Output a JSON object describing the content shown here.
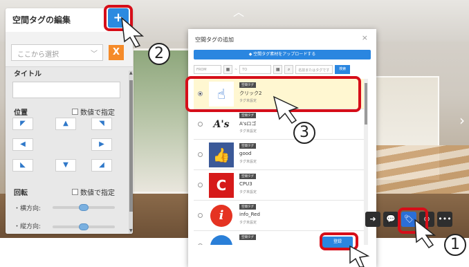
{
  "edit_panel": {
    "title": "空間タグの編集",
    "select_placeholder": "ここから選択",
    "x_label": "X",
    "title_label": "タイトル",
    "position_label": "位置",
    "position_numeric": "数値で指定",
    "rotation_label": "回転",
    "rotation_numeric": "数値で指定",
    "horizontal_label": "・横方向:",
    "vertical_label": "・縦方向:",
    "add_label": "+"
  },
  "dialog": {
    "title": "空間タグの追加",
    "close": "×",
    "upload_label": "◆ 空間タグ素材をアップロードする",
    "from_placeholder": "FROM",
    "to_placeholder": "TO",
    "tilde": "~",
    "keyword_placeholder": "名前またはタグです",
    "search_label": "検索",
    "register_label": "登録",
    "items": [
      {
        "category": "空間タグ",
        "name": "クリック2",
        "tag": "タグ未設定",
        "selected": true
      },
      {
        "category": "空間タグ",
        "name": "A'sロゴ",
        "tag": "タグ未設定",
        "selected": false
      },
      {
        "category": "空間タグ",
        "name": "good",
        "tag": "タグ未設定",
        "selected": false
      },
      {
        "category": "空間タグ",
        "name": "CPU3",
        "tag": "タグ未設定",
        "selected": false
      },
      {
        "category": "空間タグ",
        "name": "info_Red",
        "tag": "タグ未設定",
        "selected": false
      },
      {
        "category": "空間タグ",
        "name": "",
        "tag": "",
        "selected": false
      }
    ]
  },
  "callouts": {
    "one": "1",
    "two": "2",
    "three": "3"
  },
  "toolbar": {
    "more": "•••"
  }
}
